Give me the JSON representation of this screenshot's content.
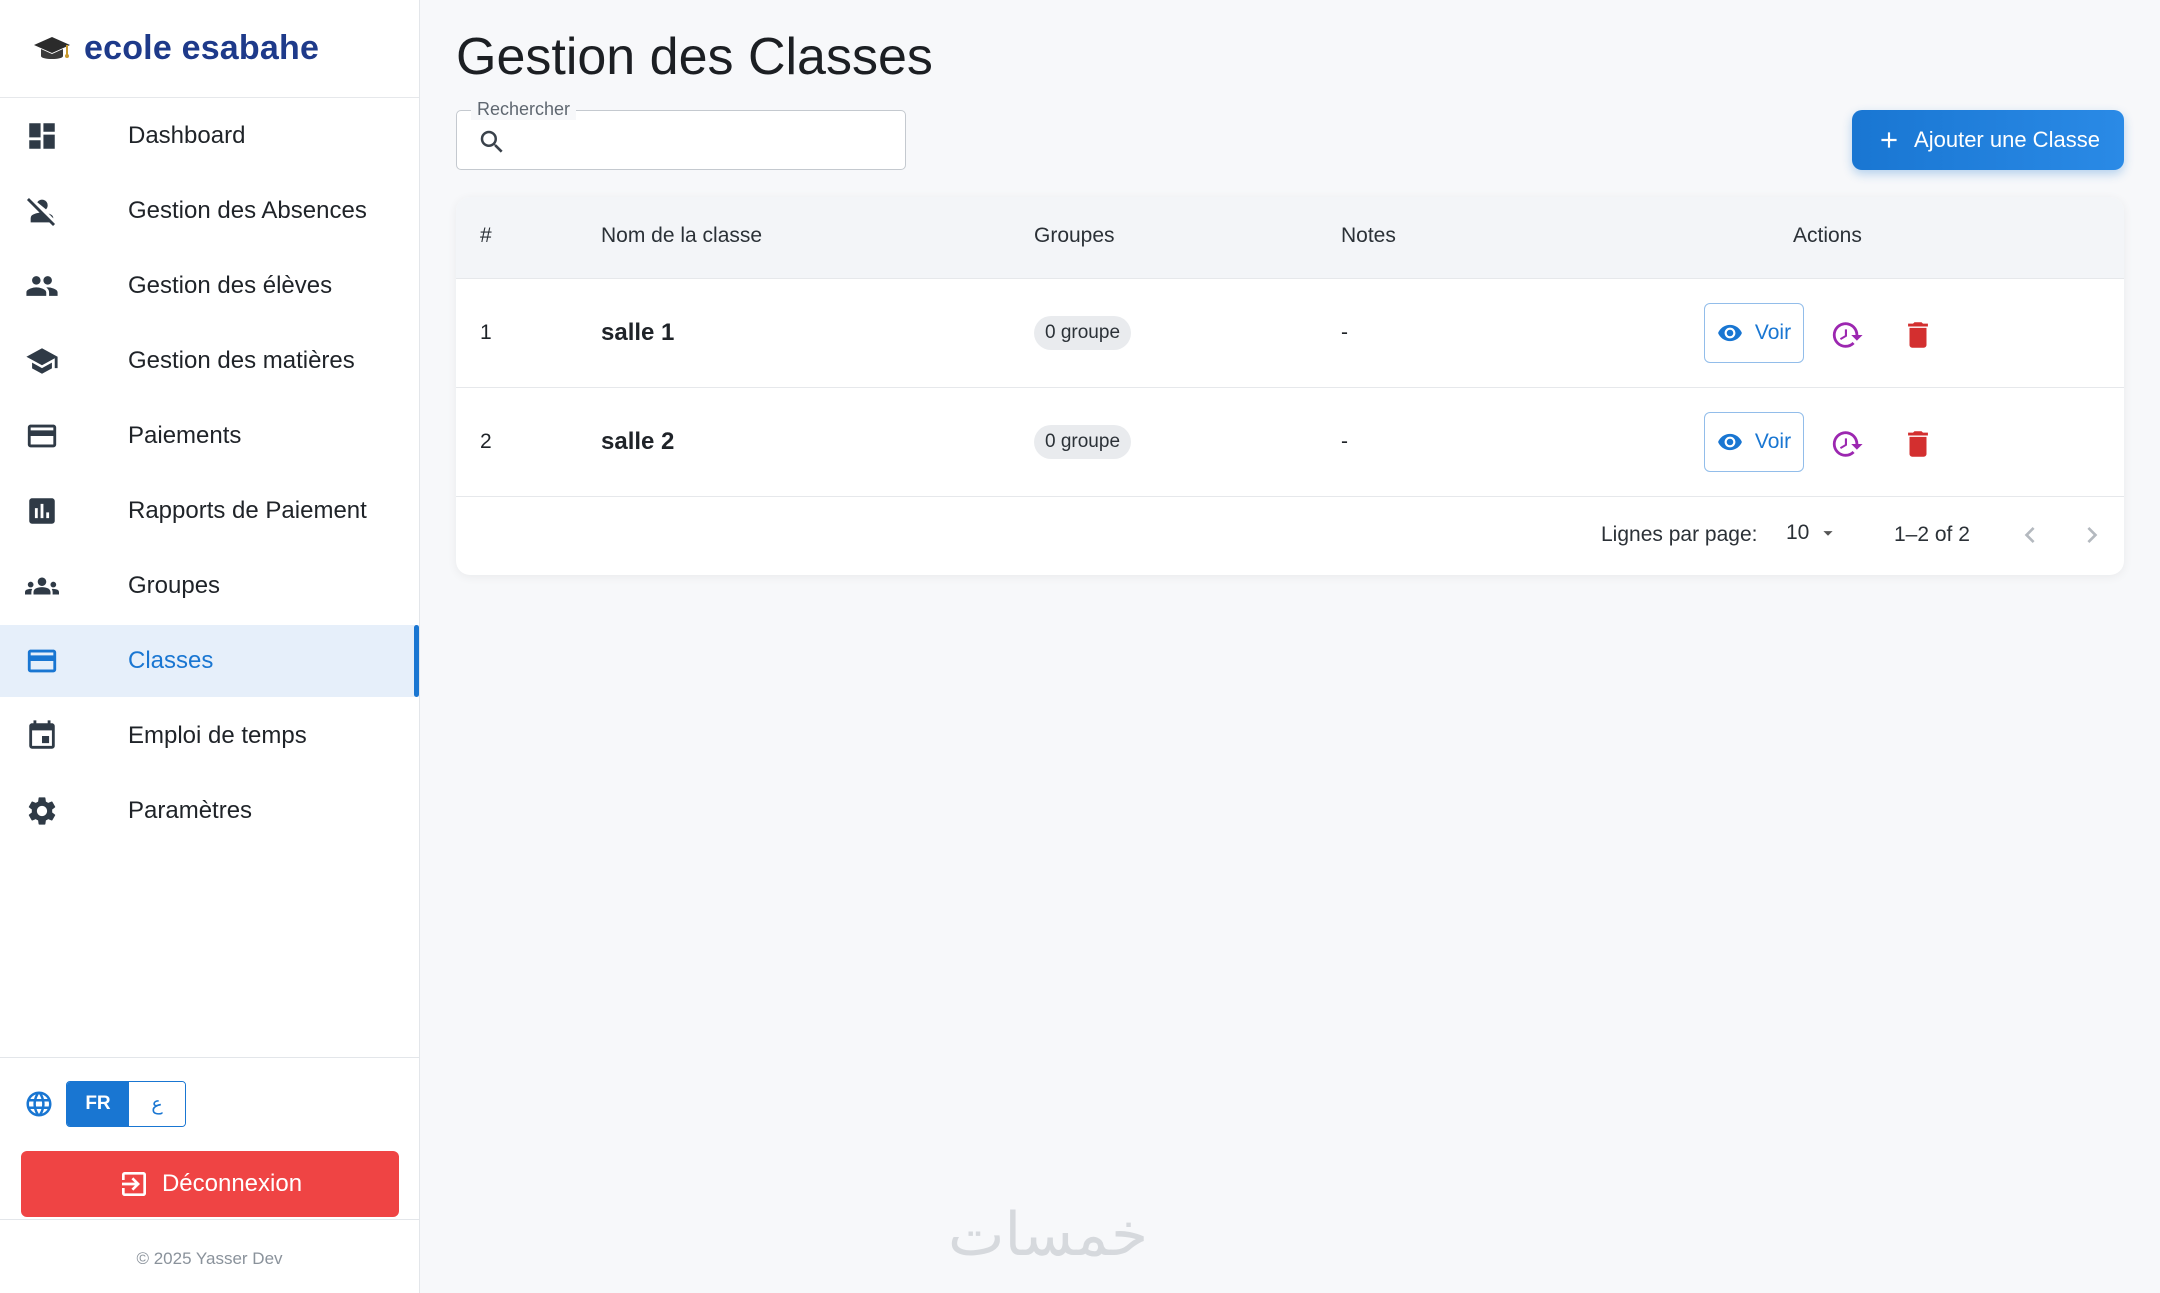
{
  "brand": {
    "name": "ecole esabahe",
    "icon": "graduation-cap-icon"
  },
  "sidebar": {
    "items": [
      {
        "label": "Dashboard",
        "icon": "dashboard-icon"
      },
      {
        "label": "Gestion des Absences",
        "icon": "person-off-icon"
      },
      {
        "label": "Gestion des élèves",
        "icon": "people-icon"
      },
      {
        "label": "Gestion des matières",
        "icon": "school-icon"
      },
      {
        "label": "Paiements",
        "icon": "credit-card-icon"
      },
      {
        "label": "Rapports de Paiement",
        "icon": "chart-icon"
      },
      {
        "label": "Groupes",
        "icon": "groups-icon"
      },
      {
        "label": "Classes",
        "icon": "credit-card-icon",
        "active": true
      },
      {
        "label": "Emploi de temps",
        "icon": "calendar-icon"
      },
      {
        "label": "Paramètres",
        "icon": "gear-icon"
      }
    ],
    "lang": {
      "fr": "FR",
      "ar": "ع"
    },
    "logout_label": "Déconnexion",
    "copyright": "© 2025 Yasser Dev"
  },
  "page": {
    "title": "Gestion des Classes",
    "search_label": "Rechercher",
    "search_value": "",
    "add_button": "Ajouter une Classe"
  },
  "table": {
    "headers": {
      "num": "#",
      "name": "Nom de la classe",
      "groups": "Groupes",
      "notes": "Notes",
      "actions": "Actions"
    },
    "rows": [
      {
        "num": "1",
        "name": "salle 1",
        "groups": "0 groupe",
        "notes": "-",
        "view": "Voir"
      },
      {
        "num": "2",
        "name": "salle 2",
        "groups": "0 groupe",
        "notes": "-",
        "view": "Voir"
      }
    ],
    "pagination": {
      "rows_per_page_label": "Lignes par page:",
      "rows_per_page": "10",
      "range": "1–2 of 2"
    }
  },
  "colors": {
    "primary": "#1976d2",
    "danger": "#ef4444",
    "history": "#9c27b0",
    "delete": "#d32f2f",
    "brand": "#1e3a8a"
  },
  "watermark": "خمسات"
}
